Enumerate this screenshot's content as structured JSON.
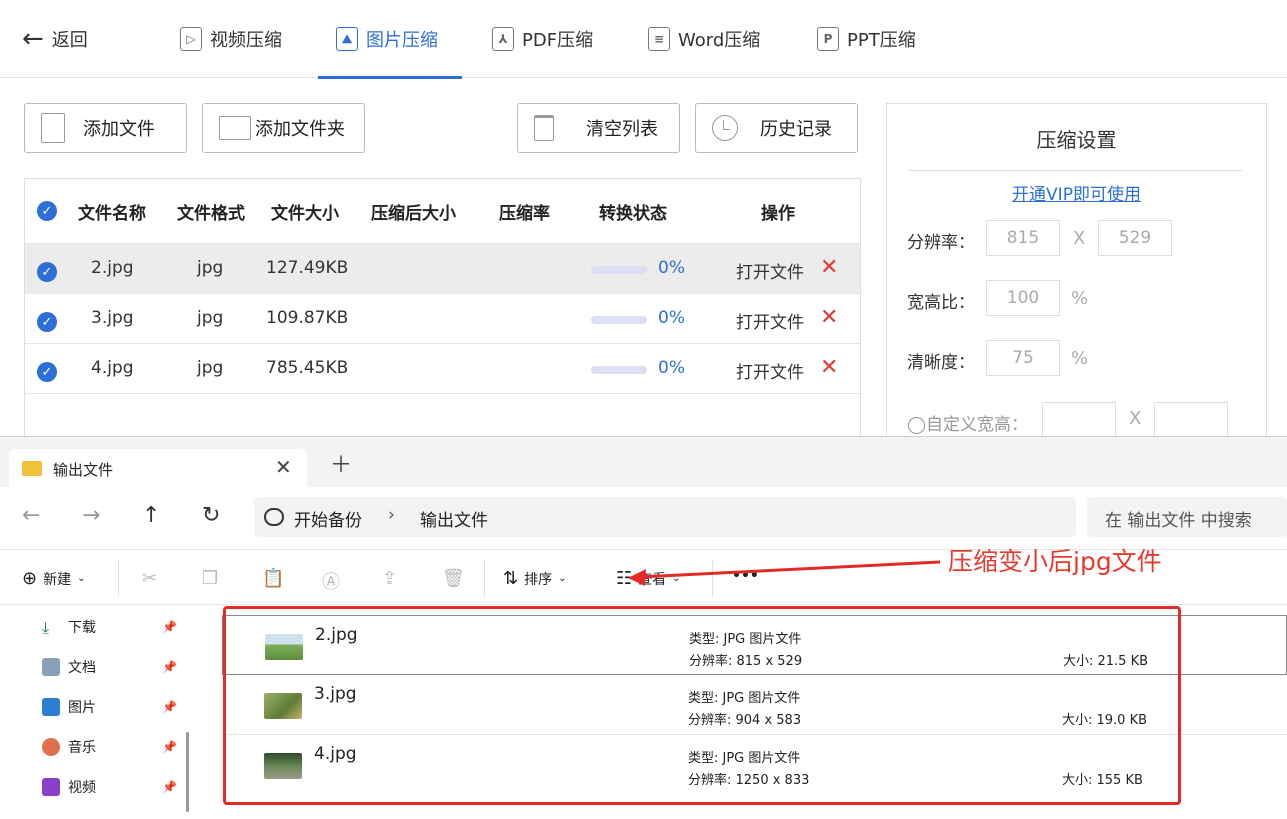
{
  "app": {
    "back_label": "返回",
    "tabs": [
      {
        "label": "视频压缩",
        "icon": "video-icon"
      },
      {
        "label": "图片压缩",
        "icon": "image-icon"
      },
      {
        "label": "PDF压缩",
        "icon": "pdf-icon"
      },
      {
        "label": "Word压缩",
        "icon": "word-icon"
      },
      {
        "label": "PPT压缩",
        "icon": "ppt-icon"
      }
    ],
    "active_tab": "图片压缩",
    "buttons": {
      "add_file": "添加文件",
      "add_folder": "添加文件夹",
      "clear_list": "清空列表",
      "history": "历史记录"
    },
    "table": {
      "headers": [
        "文件名称",
        "文件格式",
        "文件大小",
        "压缩后大小",
        "压缩率",
        "转换状态",
        "操作"
      ],
      "rows": [
        {
          "name": "2.jpg",
          "format": "jpg",
          "size": "127.49KB",
          "compressed_size": "",
          "ratio": "",
          "progress": 0,
          "status": "0%",
          "action": "打开文件"
        },
        {
          "name": "3.jpg",
          "format": "jpg",
          "size": "109.87KB",
          "compressed_size": "",
          "ratio": "",
          "progress": 0,
          "status": "0%",
          "action": "打开文件"
        },
        {
          "name": "4.jpg",
          "format": "jpg",
          "size": "785.45KB",
          "compressed_size": "",
          "ratio": "",
          "progress": 0,
          "status": "0%",
          "action": "打开文件"
        }
      ]
    },
    "settings": {
      "title": "压缩设置",
      "vip_link": "开通VIP即可使用",
      "resolution_label": "分辨率：",
      "resolution_w": "815",
      "resolution_h": "529",
      "x_sep": "X",
      "aspect_label": "宽高比：",
      "aspect_value": "100",
      "clarity_label": "清晰度：",
      "clarity_value": "75",
      "percent": "%",
      "custom_label": "◯自定义宽高："
    },
    "accent_color": "#2c6fd6"
  },
  "explorer": {
    "tab_title": "输出文件",
    "address": {
      "root": "开始备份",
      "current": "输出文件"
    },
    "search_placeholder": "在 输出文件 中搜索",
    "toolbar": {
      "new": "新建",
      "sort": "排序",
      "view": "查看",
      "more": "•••"
    },
    "annotation": "压缩变小后jpg文件",
    "sidebar": [
      {
        "label": "下载",
        "icon": "download-icon"
      },
      {
        "label": "文档",
        "icon": "document-icon"
      },
      {
        "label": "图片",
        "icon": "pictures-icon"
      },
      {
        "label": "音乐",
        "icon": "music-icon"
      },
      {
        "label": "视频",
        "icon": "videos-icon"
      }
    ],
    "files": [
      {
        "name": "2.jpg",
        "type": "类型: JPG 图片文件",
        "resolution": "分辨率: 815 x 529",
        "size": "大小: 21.5 KB"
      },
      {
        "name": "3.jpg",
        "type": "类型: JPG 图片文件",
        "resolution": "分辨率: 904 x 583",
        "size": "大小: 19.0 KB"
      },
      {
        "name": "4.jpg",
        "type": "类型: JPG 图片文件",
        "resolution": "分辨率: 1250 x 833",
        "size": "大小: 155 KB"
      }
    ],
    "highlight_color": "#e32a26"
  }
}
